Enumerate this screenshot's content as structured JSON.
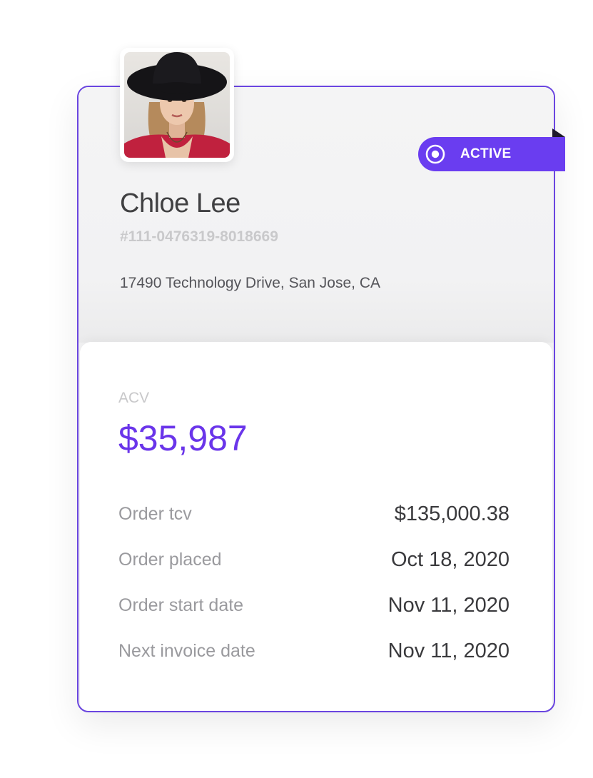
{
  "customer": {
    "name": "Chloe Lee",
    "order_id": "#111-0476319-8018669",
    "address": "17490 Technology Drive, San Jose, CA",
    "avatar_icon": "profile-photo"
  },
  "status": {
    "label": "ACTIVE",
    "icon": "target-icon",
    "color": "#6a3df0"
  },
  "acv": {
    "label": "ACV",
    "value": "$35,987",
    "color": "#6a35ea"
  },
  "details": [
    {
      "label": "Order tcv",
      "value": "$135,000.38"
    },
    {
      "label": "Order placed",
      "value": "Oct 18, 2020"
    },
    {
      "label": "Order start date",
      "value": "Nov 11, 2020"
    },
    {
      "label": "Next invoice date",
      "value": "Nov 11, 2020"
    }
  ],
  "colors": {
    "border": "#6a45e0",
    "top_background": "#f3f3f4"
  }
}
